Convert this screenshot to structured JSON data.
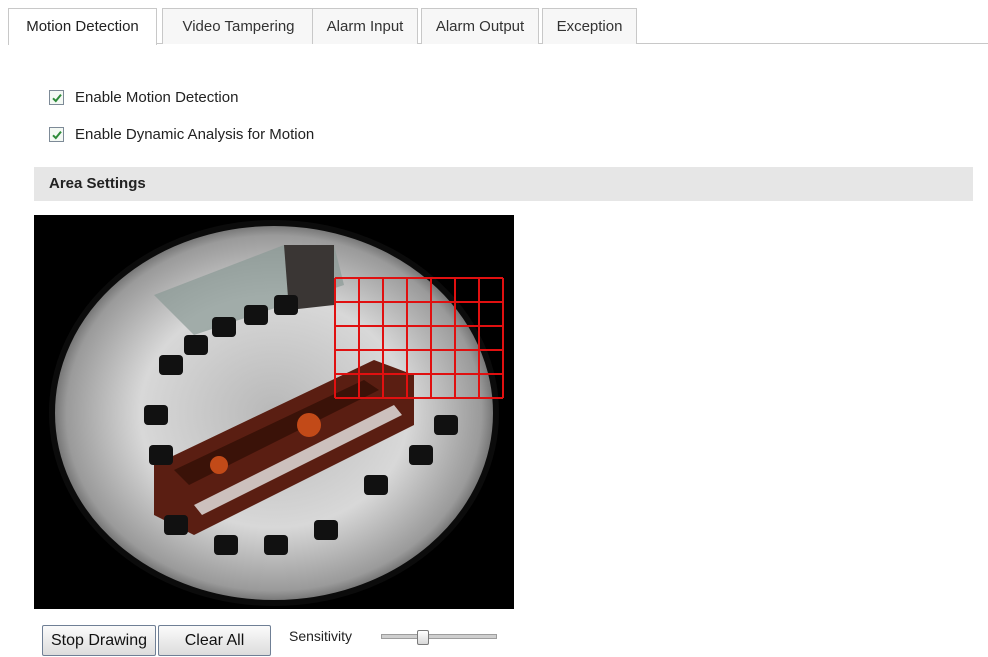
{
  "tabs": [
    {
      "label": "Motion Detection",
      "active": true
    },
    {
      "label": "Video Tampering"
    },
    {
      "label": "Alarm Input"
    },
    {
      "label": "Alarm Output"
    },
    {
      "label": "Exception"
    }
  ],
  "options": {
    "enable_motion": {
      "label": "Enable Motion Detection",
      "checked": true
    },
    "enable_dynamic": {
      "label": "Enable Dynamic Analysis for Motion",
      "checked": true
    }
  },
  "area_settings": {
    "title": "Area Settings",
    "grid_color": "#e01010"
  },
  "controls": {
    "stop_drawing": "Stop Drawing",
    "clear_all": "Clear All",
    "sensitivity_label": "Sensitivity",
    "sensitivity_value": 0.35
  },
  "colors": {
    "checkbox_check": "#2e8b3a",
    "section_bar": "#e6e6e6"
  }
}
